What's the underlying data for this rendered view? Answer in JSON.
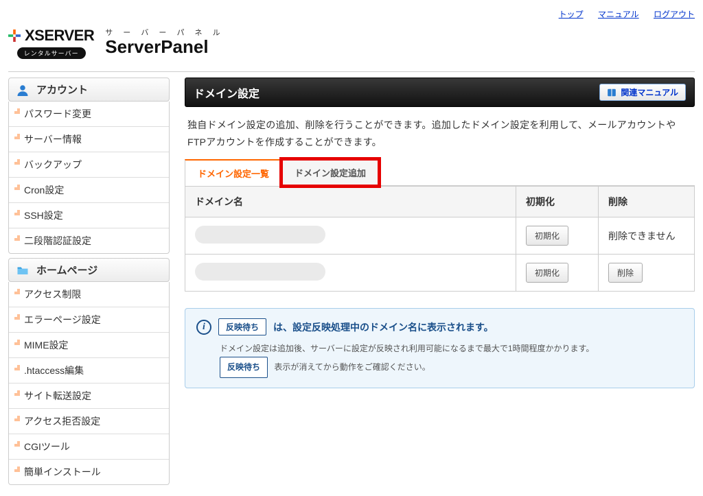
{
  "topnav": {
    "top": "トップ",
    "manual": "マニュアル",
    "logout": "ログアウト"
  },
  "brand": {
    "name": "XSERVER",
    "rental": "レンタルサーバー",
    "kana": "サ ー バ ー パ ネ ル",
    "panel": "ServerPanel"
  },
  "sidebar": {
    "account": {
      "title": "アカウント",
      "items": [
        "パスワード変更",
        "サーバー情報",
        "バックアップ",
        "Cron設定",
        "SSH設定",
        "二段階認証設定"
      ]
    },
    "homepage": {
      "title": "ホームページ",
      "items": [
        "アクセス制限",
        "エラーページ設定",
        "MIME設定",
        ".htaccess編集",
        "サイト転送設定",
        "アクセス拒否設定",
        "CGIツール",
        "簡単インストール"
      ]
    }
  },
  "main": {
    "title": "ドメイン設定",
    "manual_btn": "関連マニュアル",
    "description": "独自ドメイン設定の追加、削除を行うことができます。追加したドメイン設定を利用して、メールアカウントやFTPアカウントを作成することができます。",
    "tabs": {
      "list": "ドメイン設定一覧",
      "add": "ドメイン設定追加"
    },
    "table": {
      "h_domain": "ドメイン名",
      "h_init": "初期化",
      "h_delete": "削除",
      "btn_init": "初期化",
      "btn_delete": "削除",
      "cannot_delete": "削除できません"
    },
    "info": {
      "badge": "反映待ち",
      "line1": "は、設定反映処理中のドメイン名に表示されます。",
      "note1": "ドメイン設定は追加後、サーバーに設定が反映され利用可能になるまで最大で1時間程度かかります。",
      "note2": "表示が消えてから動作をご確認ください。"
    }
  }
}
